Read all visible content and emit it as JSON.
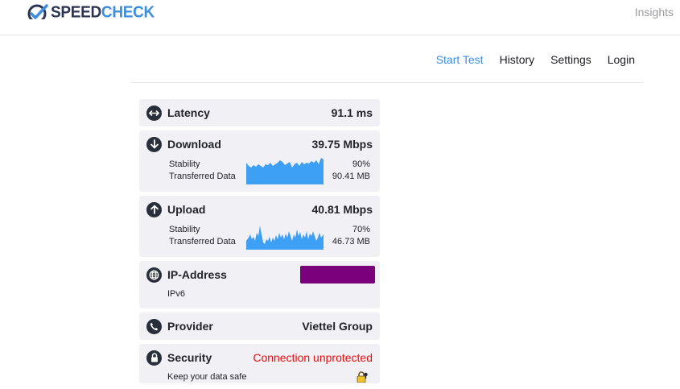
{
  "header": {
    "brand_part1": "SPEED",
    "brand_part2": "CHECK",
    "insights_label": "Insights"
  },
  "nav": {
    "start_test": "Start Test",
    "history": "History",
    "settings": "Settings",
    "login": "Login"
  },
  "colors": {
    "accent": "#3b8fde",
    "card_bg": "#f0f0f5",
    "chart_fill": "#3ea0f4",
    "error": "#e80e0e",
    "ip_mask": "#7b007b"
  },
  "latency": {
    "label": "Latency",
    "value": "91.1 ms",
    "icon": "arrows-horizontal-icon"
  },
  "download": {
    "label": "Download",
    "value": "39.75 Mbps",
    "icon": "arrow-down-icon",
    "stability_label": "Stability",
    "stability_value": "90%",
    "transferred_label": "Transferred Data",
    "transferred_value": "90.41 MB"
  },
  "upload": {
    "label": "Upload",
    "value": "40.81 Mbps",
    "icon": "arrow-up-icon",
    "stability_label": "Stability",
    "stability_value": "70%",
    "transferred_label": "Transferred Data",
    "transferred_value": "46.73 MB"
  },
  "ip": {
    "label": "IP-Address",
    "version": "IPv6",
    "icon": "globe-icon"
  },
  "provider": {
    "label": "Provider",
    "value": "Viettel Group",
    "icon": "phone-icon"
  },
  "security": {
    "label": "Security",
    "value": "Connection unprotected",
    "sub_label": "Keep your data safe",
    "icon": "lock-icon"
  }
}
